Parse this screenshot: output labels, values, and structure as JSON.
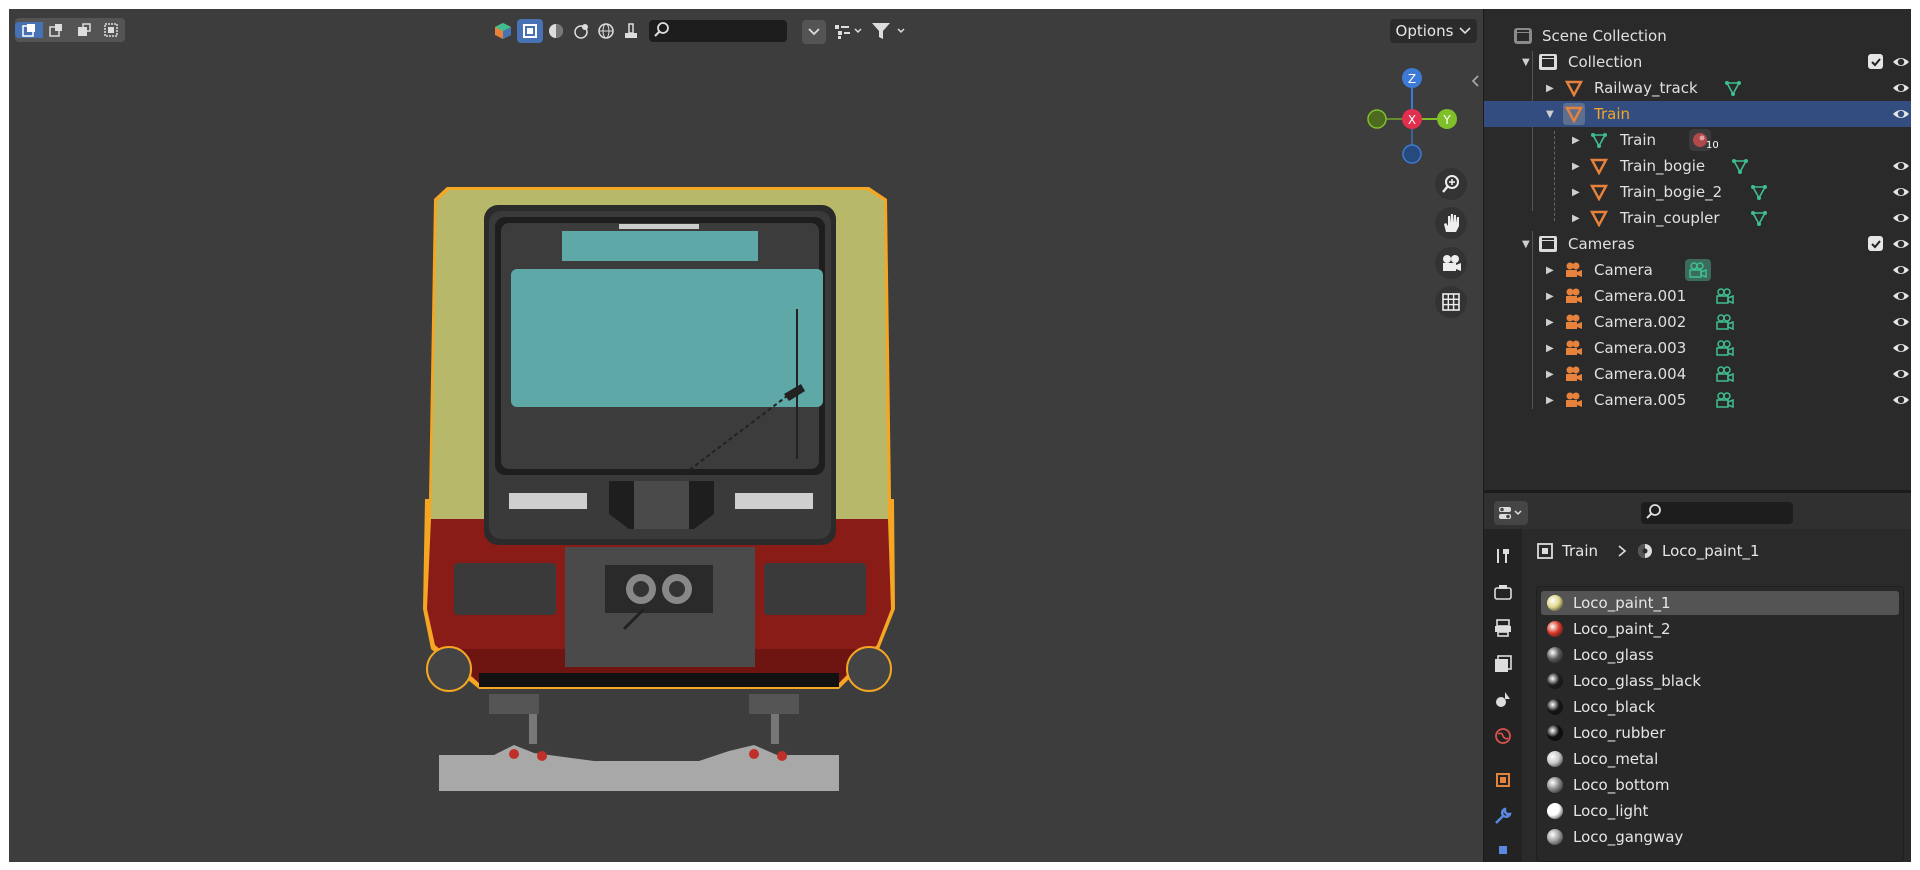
{
  "viewport": {
    "header": {
      "options_label": "Options",
      "search_value": ""
    },
    "gizmo": {
      "z_label": "Z",
      "x_label": "X",
      "y_label": "Y"
    }
  },
  "outliner": {
    "rows": [
      {
        "label": "Scene Collection"
      },
      {
        "label": "Collection"
      },
      {
        "label": "Railway_track"
      },
      {
        "label": "Train"
      },
      {
        "label": "Train"
      },
      {
        "label": "Train_bogie"
      },
      {
        "label": "Train_bogie_2"
      },
      {
        "label": "Train_coupler"
      },
      {
        "label": "Cameras"
      },
      {
        "label": "Camera"
      },
      {
        "label": "Camera.001"
      },
      {
        "label": "Camera.002"
      },
      {
        "label": "Camera.003"
      },
      {
        "label": "Camera.004"
      },
      {
        "label": "Camera.005"
      }
    ],
    "modifier_count": "10"
  },
  "properties": {
    "search_value": "",
    "breadcrumb": {
      "object": "Train",
      "material": "Loco_paint_1"
    },
    "materials": [
      {
        "name": "Loco_paint_1",
        "color": "#e0d88a"
      },
      {
        "name": "Loco_paint_2",
        "color": "#d93a2a"
      },
      {
        "name": "Loco_glass",
        "color": "#5a5a5a"
      },
      {
        "name": "Loco_glass_black",
        "color": "#1e1e1e"
      },
      {
        "name": "Loco_black",
        "color": "#151515"
      },
      {
        "name": "Loco_rubber",
        "color": "#0d0d0d"
      },
      {
        "name": "Loco_metal",
        "color": "#c9c9c9"
      },
      {
        "name": "Loco_bottom",
        "color": "#8a8a8a"
      },
      {
        "name": "Loco_light",
        "color": "#ffffff"
      },
      {
        "name": "Loco_gangway",
        "color": "#a0a0a0"
      }
    ]
  },
  "colors": {
    "accent": "#4772b3",
    "selection_outline": "#f5a623",
    "object_orange": "#e6823c",
    "data_green": "#3fbf8f",
    "train_yellow": "#b8b86b",
    "train_red": "#8a1c18",
    "window_teal": "#5fa8a8"
  }
}
